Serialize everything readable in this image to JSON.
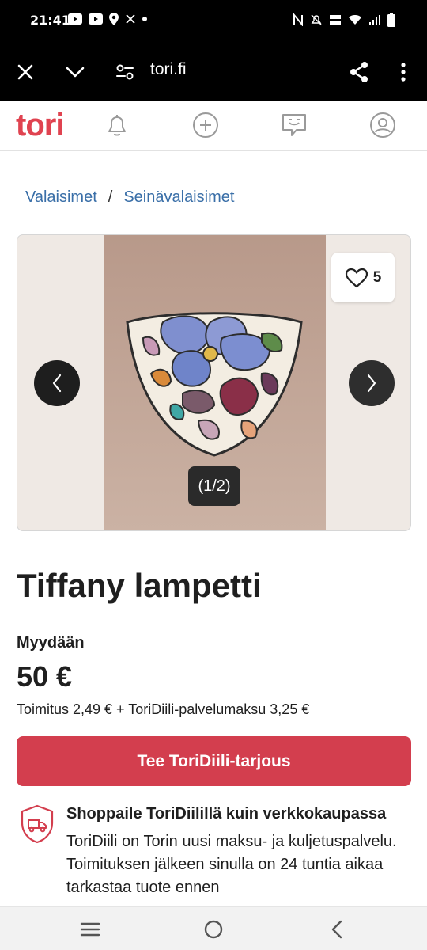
{
  "status_bar": {
    "time": "21:41",
    "left_icons": [
      "youtube-icon",
      "youtube-icon",
      "location-icon",
      "x-icon",
      "dot-icon"
    ],
    "right_icons": [
      "nfc-icon",
      "mute-icon",
      "volte-icon",
      "wifi-icon",
      "signal-icon",
      "battery-icon"
    ]
  },
  "browser": {
    "url": "tori.fi",
    "icons": [
      "close-icon",
      "chevron-down-icon",
      "site-settings-icon",
      "share-icon",
      "more-icon"
    ]
  },
  "header": {
    "logo": "tori",
    "brand_color": "#e04350",
    "icons": [
      "bell-icon",
      "add-listing-icon",
      "messages-icon",
      "profile-icon"
    ]
  },
  "breadcrumb": {
    "items": [
      "Valaisimet",
      "Seinävalaisimet"
    ],
    "separator": "/"
  },
  "gallery": {
    "favorite_count": "5",
    "counter": "(1/2)",
    "current_image": 1,
    "total_images": 2
  },
  "listing": {
    "title": "Tiffany lampetti",
    "sale_type": "Myydään",
    "price": "50 €",
    "shipping": "Toimitus 2,49 € + ToriDiili-palvelumaksu 3,25 €"
  },
  "cta": {
    "label": "Tee ToriDiili-tarjous",
    "color": "#d33e4e"
  },
  "promo": {
    "title": "Shoppaile ToriDiilillä kuin verkkokaupassa",
    "body": "ToriDiili on Torin uusi maksu- ja kuljetuspalvelu. Toimituksen jälkeen sinulla on 24 tuntia aikaa tarkastaa tuote ennen"
  },
  "system_nav": {
    "icons": [
      "recents-icon",
      "home-icon",
      "back-icon"
    ]
  }
}
